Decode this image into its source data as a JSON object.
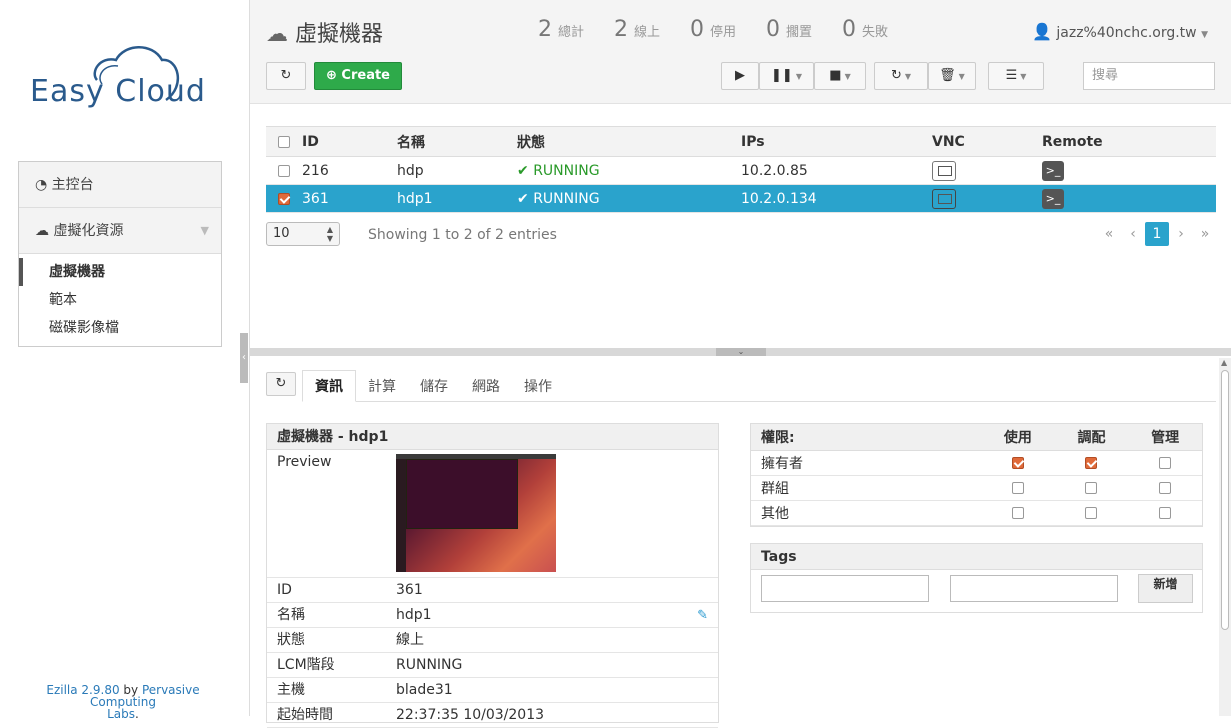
{
  "logo": {
    "text": "Easy Cloud"
  },
  "sidebar": {
    "items": [
      {
        "label": "主控台"
      },
      {
        "label": "虛擬化資源"
      }
    ],
    "subitems": [
      {
        "label": "虛擬機器"
      },
      {
        "label": "範本"
      },
      {
        "label": "磁碟影像檔"
      }
    ]
  },
  "footer": {
    "version": "Ezilla 2.9.80",
    "by": " by ",
    "org": "Pervasive Computing",
    "org2": "Labs",
    "dot": "."
  },
  "header": {
    "title": "虛擬機器",
    "stats": [
      {
        "count": "2",
        "label": "總計"
      },
      {
        "count": "2",
        "label": "線上"
      },
      {
        "count": "0",
        "label": "停用"
      },
      {
        "count": "0",
        "label": "擱置"
      },
      {
        "count": "0",
        "label": "失敗"
      }
    ],
    "user": "jazz%40nchc.org.tw"
  },
  "toolbar": {
    "refresh_icon": "↻",
    "create_label": "Create",
    "search_placeholder": "搜尋"
  },
  "table": {
    "headers": [
      "ID",
      "名稱",
      "狀態",
      "IPs",
      "VNC",
      "Remote"
    ],
    "rows": [
      {
        "id": "216",
        "name": "hdp",
        "status": "RUNNING",
        "ip": "10.2.0.85",
        "selected": false
      },
      {
        "id": "361",
        "name": "hdp1",
        "status": "RUNNING",
        "ip": "10.2.0.134",
        "selected": true
      }
    ]
  },
  "pager": {
    "page_size": "10",
    "showing": "Showing 1 to 2 of 2 entries",
    "first": "«",
    "prev": "‹",
    "current": "1",
    "next": "›",
    "last": "»"
  },
  "tabs": [
    "資訊",
    "計算",
    "儲存",
    "網路",
    "操作"
  ],
  "info": {
    "title": "虛擬機器 - hdp1",
    "preview_label": "Preview",
    "rows": [
      {
        "k": "ID",
        "v": "361"
      },
      {
        "k": "名稱",
        "v": "hdp1"
      },
      {
        "k": "狀態",
        "v": "線上"
      },
      {
        "k": "LCM階段",
        "v": "RUNNING"
      },
      {
        "k": "主機",
        "v": "blade31"
      },
      {
        "k": "起始時間",
        "v": "22:37:35 10/03/2013"
      }
    ]
  },
  "permissions": {
    "header": "權限:",
    "cols": [
      "使用",
      "調配",
      "管理"
    ],
    "rows": [
      {
        "label": "擁有者",
        "use": true,
        "manage": true,
        "admin": false
      },
      {
        "label": "群組",
        "use": false,
        "manage": false,
        "admin": false
      },
      {
        "label": "其他",
        "use": false,
        "manage": false,
        "admin": false
      }
    ]
  },
  "tags": {
    "title": "Tags",
    "add_label": "新增"
  },
  "colors": {
    "accent": "#2aa3cc",
    "create": "#2eaa4a",
    "running": "#2a9a2a"
  }
}
